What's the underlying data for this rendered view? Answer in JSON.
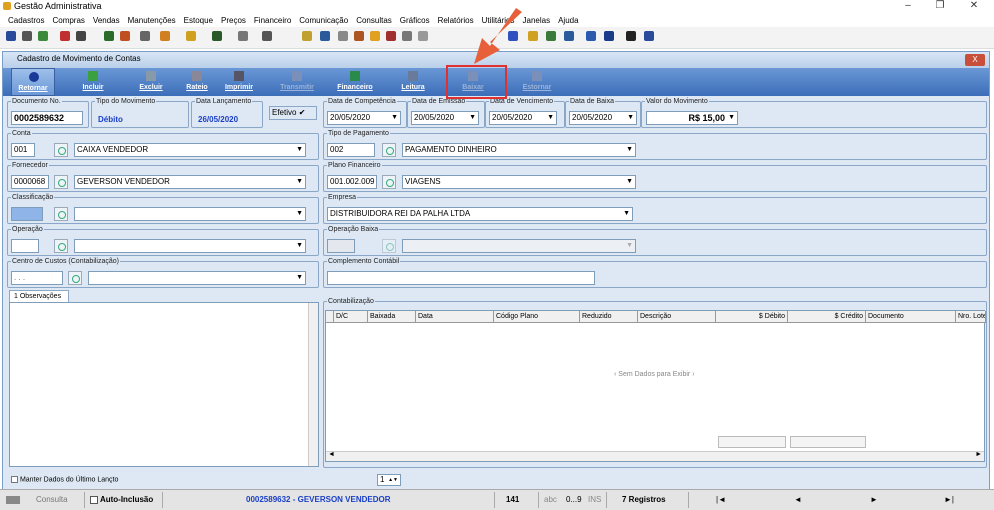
{
  "app": {
    "title": "Gestão Administrativa"
  },
  "window_buttons": [
    "–",
    "❐",
    "✕"
  ],
  "menu": [
    "Cadastros",
    "Compras",
    "Vendas",
    "Manutenções",
    "Estoque",
    "Preços",
    "Financeiro",
    "Comunicação",
    "Consultas",
    "Gráficos",
    "Relatórios",
    "Utilitários",
    "Janelas",
    "Ajuda"
  ],
  "window": {
    "title": "Cadastro de Movimento de Contas",
    "close": "X"
  },
  "actions": [
    {
      "label": "Retornar",
      "icon": "back-icon",
      "enabled": true
    },
    {
      "label": "Incluir",
      "icon": "plus-icon",
      "enabled": true
    },
    {
      "label": "Excluir",
      "icon": "trash-icon",
      "enabled": true
    },
    {
      "label": "Rateio",
      "icon": "split-icon",
      "enabled": true
    },
    {
      "label": "Imprimir",
      "icon": "printer-icon",
      "enabled": true
    },
    {
      "label": "Transmitir",
      "icon": "transmit-icon",
      "enabled": false
    },
    {
      "label": "Financeiro",
      "icon": "money-icon",
      "enabled": true
    },
    {
      "label": "Leitura",
      "icon": "reader-icon",
      "enabled": true
    },
    {
      "label": "Baixar",
      "icon": "check-icon",
      "enabled": false
    },
    {
      "label": "Estornar",
      "icon": "x-icon",
      "enabled": false
    }
  ],
  "colors": {
    "accent": "#3c6db8",
    "highlight": "#e03030",
    "arrow": "#e8603a"
  },
  "form": {
    "documento": {
      "label": "Documento No.",
      "value": "0002589632"
    },
    "tipo_movimento": {
      "label": "Tipo do Movimento",
      "value": "Débito"
    },
    "data_lancamento": {
      "label": "Data Lançamento",
      "value": "26/05/2020"
    },
    "efetivo": {
      "label": "Efetivo",
      "checked": "✔"
    },
    "data_competencia": {
      "label": "Data de Competência",
      "value": "20/05/2020"
    },
    "data_emissao": {
      "label": "Data de Emissão",
      "value": "20/05/2020"
    },
    "data_vencimento": {
      "label": "Data de Vencimento",
      "value": "20/05/2020"
    },
    "data_baixa": {
      "label": "Data de Baixa",
      "value": "20/05/2020"
    },
    "valor": {
      "label": "Valor do Movimento",
      "value": "R$ 15,00"
    },
    "conta": {
      "label": "Conta",
      "code": "001",
      "value": "CAIXA VENDEDOR"
    },
    "tipo_pagamento": {
      "label": "Tipo de Pagamento",
      "code": "002",
      "value": "PAGAMENTO DINHEIRO"
    },
    "fornecedor": {
      "label": "Fornecedor",
      "code": "0000068",
      "value": "GEVERSON VENDEDOR"
    },
    "plano": {
      "label": "Plano Financeiro",
      "code": "001.002.009",
      "value": "VIAGENS"
    },
    "classificacao": {
      "label": "Classificação",
      "code": "",
      "value": ""
    },
    "empresa": {
      "label": "Empresa",
      "value": "DISTRIBUIDORA REI DA PALHA LTDA"
    },
    "operacao": {
      "label": "Operação",
      "code": "",
      "value": ""
    },
    "operacao_baixa": {
      "label": "Operação Baixa",
      "code": "",
      "value": ""
    },
    "centro_custos": {
      "label": "Centro de Custos (Contabilização)",
      "code": ". . .",
      "value": ""
    },
    "complemento": {
      "label": "Complemento Contábil",
      "value": ""
    }
  },
  "tabs": {
    "observacoes": "1 Observações"
  },
  "contab": {
    "label": "Contabilização",
    "columns": [
      "D/C",
      "Baixada",
      "Data",
      "Código Plano",
      "Reduzido",
      "Descrição",
      "$ Débito",
      "$ Crédito",
      "Documento",
      "Nro. Lote"
    ],
    "empty": "‹ Sem Dados para Exibir ›"
  },
  "bottom": {
    "manter": "Manter Dados do Último Lançto",
    "spinner": "1"
  },
  "status": {
    "consulta": "Consulta",
    "auto": "Auto-Inclusão",
    "record": "0002589632 - GEVERSON VENDEDOR",
    "count": "141",
    "abc": "abc",
    "range": "0...9",
    "ins": "INS",
    "registros": "7 Registros",
    "nav": [
      "|◄",
      "◄",
      "►",
      "►|"
    ]
  }
}
